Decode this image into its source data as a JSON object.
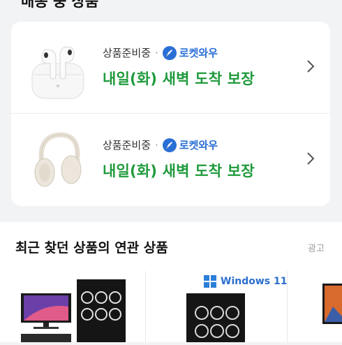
{
  "header": {
    "section_title": "배송 중 상품"
  },
  "orders": [
    {
      "status": "상품준비중",
      "separator": "·",
      "badge": "로켓와우",
      "delivery": "내일(화) 새벽 도착 보장",
      "thumbnail_icon": "earbuds-icon"
    },
    {
      "status": "상품준비중",
      "separator": "·",
      "badge": "로켓와우",
      "delivery": "내일(화) 새벽 도착 보장",
      "thumbnail_icon": "headphones-icon"
    }
  ],
  "recommendations": {
    "title": "최근 찾던 상품의 연관 상품",
    "ad_label": "광고",
    "products": [
      {
        "icon": "pc-monitor-bundle-icon"
      },
      {
        "icon": "pc-case-icon",
        "badge": "Windows 11"
      },
      {
        "icon": "monitor-icon"
      }
    ]
  },
  "colors": {
    "delivery_green": "#1f9a3c",
    "rocket_blue": "#2a6fd6",
    "background": "#f2f3f5"
  }
}
